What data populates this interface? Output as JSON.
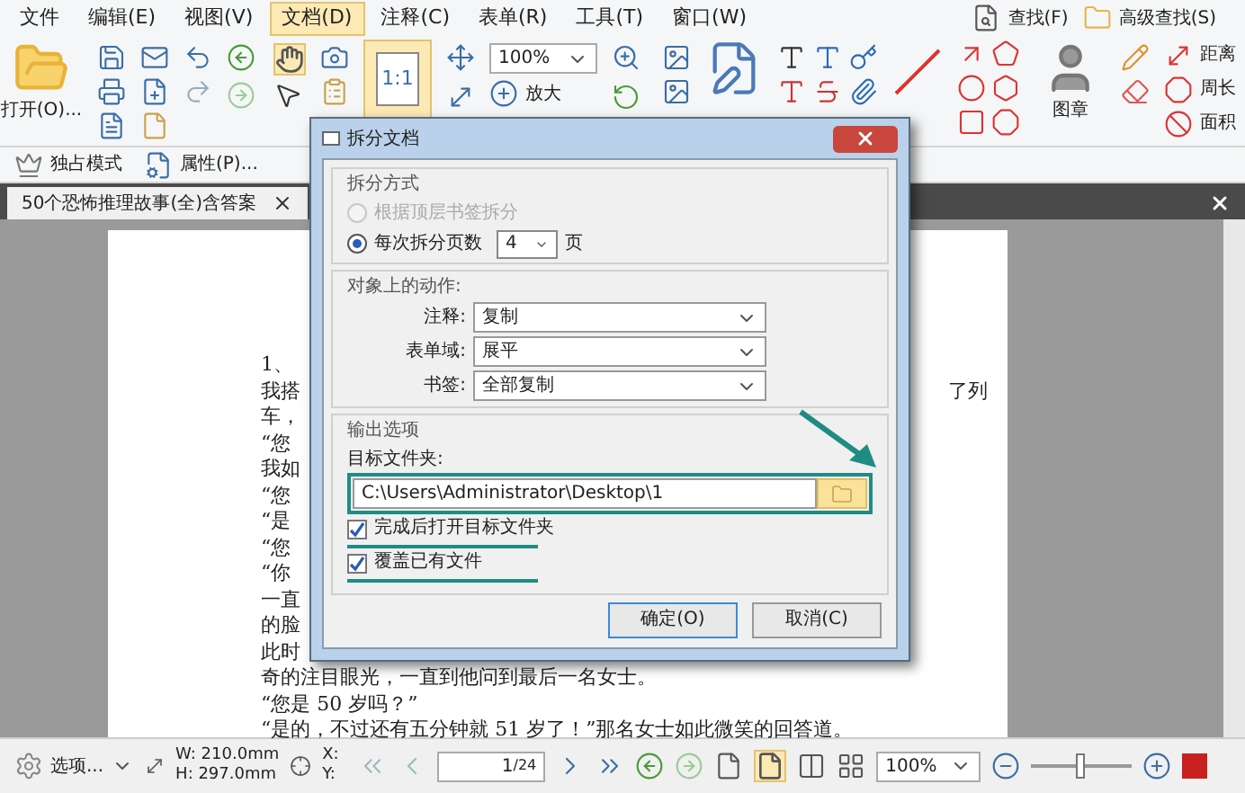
{
  "menu": [
    {
      "label": "文件",
      "selected": false
    },
    {
      "label": "编辑(E)",
      "selected": false
    },
    {
      "label": "视图(V)",
      "selected": false
    },
    {
      "label": "文档(D)",
      "selected": true
    },
    {
      "label": "注释(C)",
      "selected": false
    },
    {
      "label": "表单(R)",
      "selected": false
    },
    {
      "label": "工具(T)",
      "selected": false
    },
    {
      "label": "窗口(W)",
      "selected": false
    }
  ],
  "search_buttons": [
    "查找(F)",
    "高级查找(S)"
  ],
  "ribbon": {
    "open_label": "打开(O)...",
    "actual_size_text": "1:1",
    "zoom_value": "100%",
    "zoom_in_label": "放大",
    "stamp_label": "图章",
    "measure": [
      "距离",
      "周长",
      "面积"
    ]
  },
  "toolbar": [
    "独占模式",
    "属性(P)..."
  ],
  "tab": {
    "title": "50个恐怖推理故事(全)含答案"
  },
  "page": {
    "lines": [
      "1、",
      "我搭",
      "车，",
      "“您",
      "我如",
      "“您",
      "“是",
      "“您",
      "“你",
      "一直",
      "的脸",
      "此时",
      "奇的注目眼光，一直到他问到最后一名女士。",
      "“您是 50 岁吗？”",
      "“是的，不过还有五分钟就 51 岁了！”那名女士如此微笑的回答道。"
    ],
    "right_fragment": "了列"
  },
  "dialog": {
    "title": "拆分文档",
    "split": {
      "heading": "拆分方式",
      "options": [
        {
          "label": "根据顶层书签拆分",
          "selected": false,
          "disabled": true
        },
        {
          "label": "每次拆分页数",
          "selected": true,
          "disabled": false
        }
      ],
      "pages_value": "4",
      "pages_unit": "页"
    },
    "actions": {
      "heading": "对象上的动作:",
      "rows": [
        {
          "label": "注释:",
          "value": "复制"
        },
        {
          "label": "表单域:",
          "value": "展平"
        },
        {
          "label": "书签:",
          "value": "全部复制"
        }
      ]
    },
    "output": {
      "heading": "输出选项",
      "folder_label": "目标文件夹:",
      "folder_value": "C:\\Users\\Administrator\\Desktop\\1",
      "checks": [
        {
          "label": "完成后打开目标文件夹",
          "checked": true
        },
        {
          "label": "覆盖已有文件",
          "checked": true
        }
      ]
    },
    "buttons": [
      "确定(O)",
      "取消(C)"
    ]
  },
  "status": {
    "options": "选项...",
    "width": "W: 210.0mm",
    "height": "H: 297.0mm",
    "x": "X:",
    "y": "Y:",
    "page_value": "1",
    "page_total": "/24",
    "zoom": "100%",
    "zoom_slider": {
      "level": 0.5
    }
  }
}
